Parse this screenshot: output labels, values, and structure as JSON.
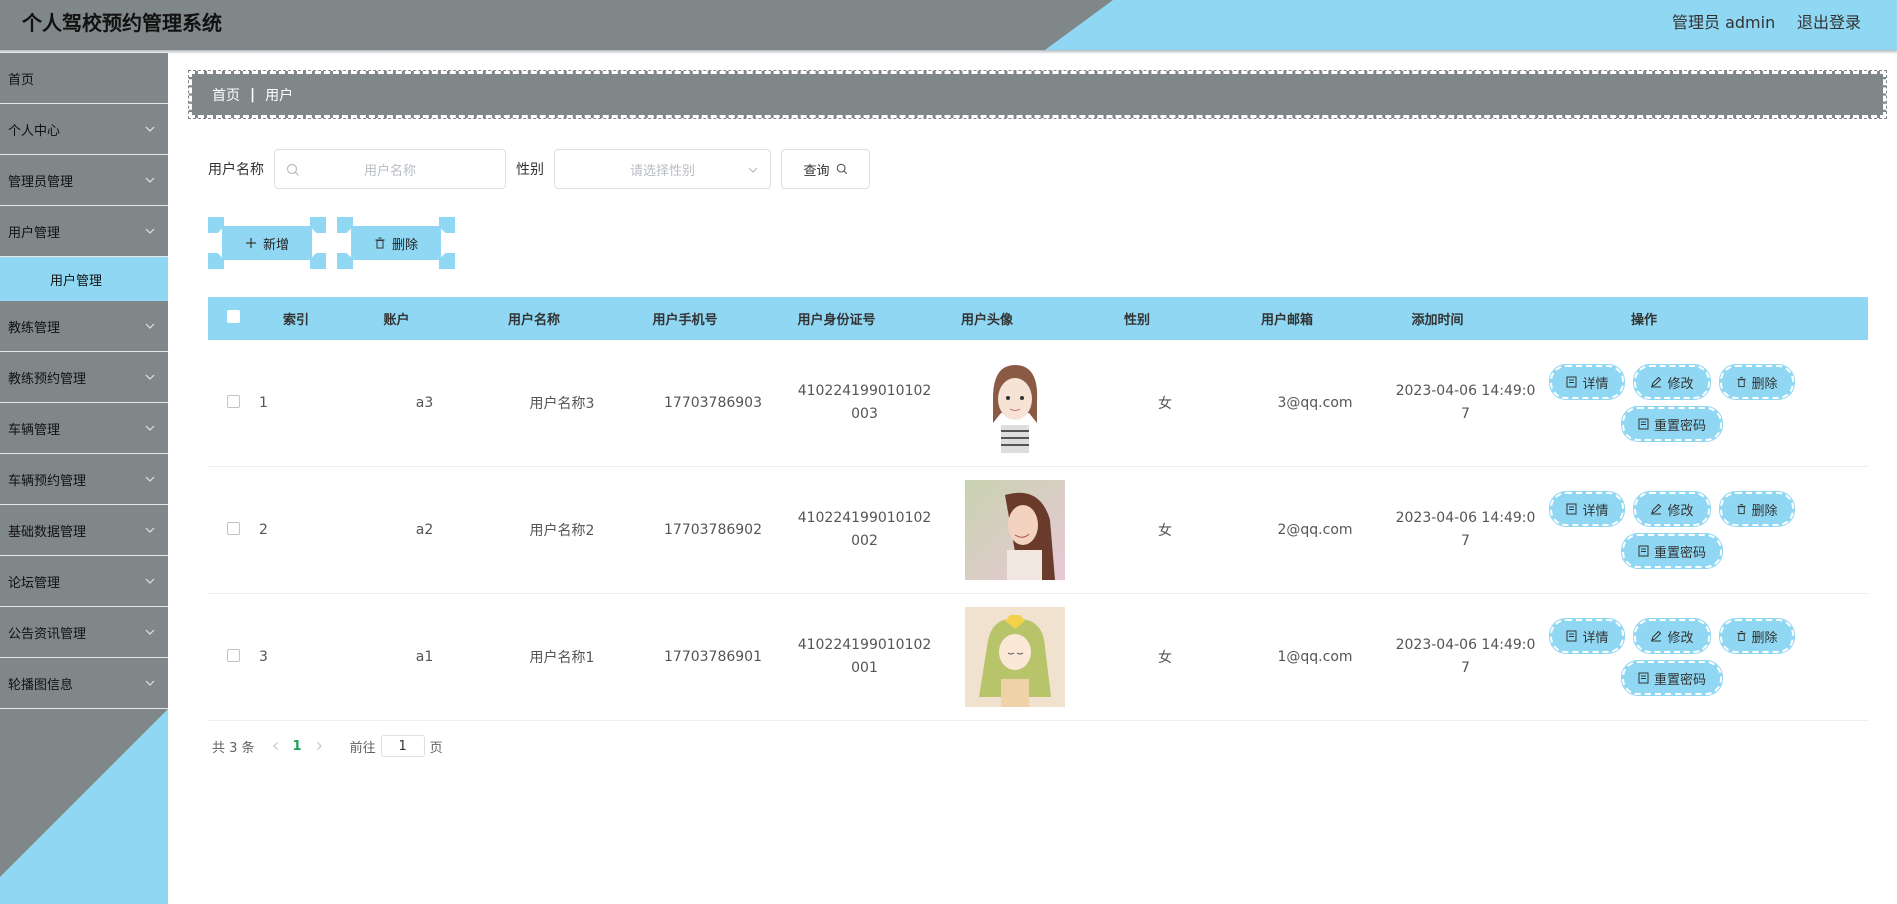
{
  "header": {
    "title": "个人驾校预约管理系统",
    "admin": "管理员 admin",
    "logout": "退出登录"
  },
  "sidebar": {
    "items": [
      {
        "label": "首页"
      },
      {
        "label": "个人中心"
      },
      {
        "label": "管理员管理"
      },
      {
        "label": "用户管理"
      },
      {
        "label": "教练管理"
      },
      {
        "label": "教练预约管理"
      },
      {
        "label": "车辆管理"
      },
      {
        "label": "车辆预约管理"
      },
      {
        "label": "基础数据管理"
      },
      {
        "label": "论坛管理"
      },
      {
        "label": "公告资讯管理"
      },
      {
        "label": "轮播图信息"
      }
    ],
    "active_sub": "用户管理"
  },
  "breadcrumb": {
    "home": "首页",
    "sep": "|",
    "current": "用户"
  },
  "search": {
    "name_label": "用户名称",
    "name_placeholder": "用户名称",
    "gender_label": "性别",
    "gender_placeholder": "请选择性别",
    "query_label": "查询"
  },
  "actions": {
    "add": "新增",
    "delete": "删除"
  },
  "table": {
    "headers": [
      "索引",
      "账户",
      "用户名称",
      "用户手机号",
      "用户身份证号",
      "用户头像",
      "性别",
      "用户邮箱",
      "添加时间",
      "操作"
    ],
    "rows": [
      {
        "index": "1",
        "account": "a3",
        "name": "用户名称3",
        "phone": "17703786903",
        "id1": "410224199010102",
        "id2": "003",
        "gender": "女",
        "email": "3@qq.com",
        "time1": "2023-04-06 14:49:0",
        "time2": "7",
        "avatar": "avatar-3"
      },
      {
        "index": "2",
        "account": "a2",
        "name": "用户名称2",
        "phone": "17703786902",
        "id1": "410224199010102",
        "id2": "002",
        "gender": "女",
        "email": "2@qq.com",
        "time1": "2023-04-06 14:49:0",
        "time2": "7",
        "avatar": "avatar-2"
      },
      {
        "index": "3",
        "account": "a1",
        "name": "用户名称1",
        "phone": "17703786901",
        "id1": "410224199010102",
        "id2": "001",
        "gender": "女",
        "email": "1@qq.com",
        "time1": "2023-04-06 14:49:0",
        "time2": "7",
        "avatar": "avatar-1"
      }
    ],
    "ops": {
      "detail": "详情",
      "edit": "修改",
      "delete": "删除",
      "reset": "重置密码"
    }
  },
  "pagination": {
    "total": "共 3 条",
    "page": "1",
    "goto": "前往",
    "goto_value": "1",
    "unit": "页"
  },
  "colors": {
    "accent": "#8fd7f2",
    "dark": "#808789"
  }
}
